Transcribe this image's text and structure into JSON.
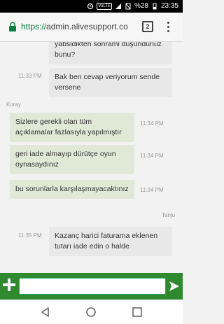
{
  "status_bar": {
    "volte": "VoLTE",
    "battery": "%28",
    "time": "23:35"
  },
  "browser": {
    "url_scheme": "https://",
    "url_host": "admin.alivesupport.co",
    "tab_count": "2"
  },
  "messages": [
    {
      "type": "agent",
      "text": "yabsidikten sonrami düşündünüz bunu?",
      "time": ""
    },
    {
      "type": "agent",
      "text": "Bak ben cevap veriyorum sende versene",
      "time": "11:33 PM"
    },
    {
      "type": "user",
      "sender": "Koray",
      "text": "Sizlere gerekli olan tüm açıklamalar fazlasıyla yapılmıştır",
      "time": "11:34 PM"
    },
    {
      "type": "user",
      "text": "geri iade almayıp dürütçe oyun oynasaydınız",
      "time": "11:34 PM"
    },
    {
      "type": "user",
      "text": "bu sorunlarla karşılaşmayacaktınız",
      "time": "11:34 PM"
    },
    {
      "type": "agent",
      "sender": "Tanju",
      "text": "Kazanç harici faturama eklenen tutarı iade edin o halde",
      "time": "11:35 PM"
    }
  ],
  "composer": {
    "placeholder": "",
    "value": ""
  },
  "colors": {
    "composer_bg": "#2f8a2f",
    "user_bubble": "#dfe9d6",
    "agent_bubble": "#e8e8e8",
    "secure_green": "#0b8043"
  }
}
